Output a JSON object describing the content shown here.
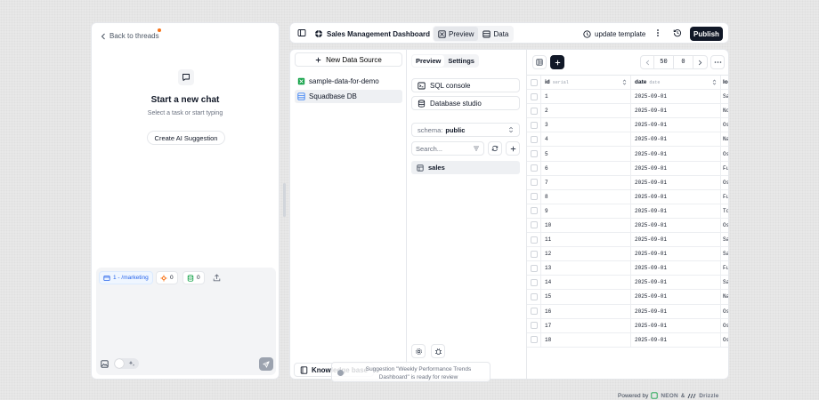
{
  "chat": {
    "back_label": "Back to threads",
    "title": "Start a new chat",
    "subtitle": "Select a task or start typing",
    "suggestion_button": "Create AI Suggestion",
    "chips": {
      "folder": "1 - /marketing",
      "git_count": "0",
      "db_count": "0"
    }
  },
  "topbar": {
    "project": "Sales Management Dashboard",
    "preview_label": "Preview",
    "data_label": "Data",
    "update_template": "update template",
    "publish": "Publish"
  },
  "sources": {
    "new_button": "New Data Source",
    "items": [
      {
        "label": "sample-data-for-demo",
        "icon": "spreadsheet-icon",
        "color": "#16a34a"
      },
      {
        "label": "Squadbase DB",
        "icon": "database-icon",
        "color": "#3b82f6"
      }
    ],
    "knowledge": "Knowledge base"
  },
  "tools": {
    "tabs": [
      "Preview",
      "Settings"
    ],
    "sql_console": "SQL console",
    "db_studio": "Database studio",
    "schema_label": "schema:",
    "schema_value": "public",
    "search_placeholder": "Search...",
    "tables": [
      "sales"
    ]
  },
  "grid": {
    "limit": "50",
    "offset": "0",
    "columns": [
      {
        "name": "id",
        "type": "serial"
      },
      {
        "name": "date",
        "type": "date"
      },
      {
        "name": "lo",
        "type": ""
      }
    ],
    "rows": [
      [
        "1",
        "2025-09-01",
        "Sa"
      ],
      [
        "2",
        "2025-09-01",
        "No"
      ],
      [
        "3",
        "2025-09-01",
        "Os"
      ],
      [
        "4",
        "2025-09-01",
        "Na"
      ],
      [
        "5",
        "2025-09-01",
        "Os"
      ],
      [
        "6",
        "2025-09-01",
        "Fu"
      ],
      [
        "7",
        "2025-09-01",
        "Os"
      ],
      [
        "8",
        "2025-09-01",
        "Fu"
      ],
      [
        "9",
        "2025-09-01",
        "To"
      ],
      [
        "10",
        "2025-09-01",
        "Os"
      ],
      [
        "11",
        "2025-09-01",
        "Sa"
      ],
      [
        "12",
        "2025-09-01",
        "Sa"
      ],
      [
        "13",
        "2025-09-01",
        "Fu"
      ],
      [
        "14",
        "2025-09-01",
        "Sa"
      ],
      [
        "15",
        "2025-09-01",
        "Na"
      ],
      [
        "16",
        "2025-09-01",
        "Os"
      ],
      [
        "17",
        "2025-09-01",
        "Os"
      ],
      [
        "18",
        "2025-09-01",
        "Os"
      ]
    ]
  },
  "footer": {
    "powered_by": "Powered by",
    "brand1": "NEON",
    "amp": "&",
    "brand2": "Drizzle"
  },
  "toast": {
    "message": "Suggestion \"Weekly Performance Trends Dashboard\" is ready for review"
  },
  "colors": {
    "accent_orange": "#f97316",
    "primary_dark": "#111827",
    "folder_blue": "#2563eb"
  }
}
